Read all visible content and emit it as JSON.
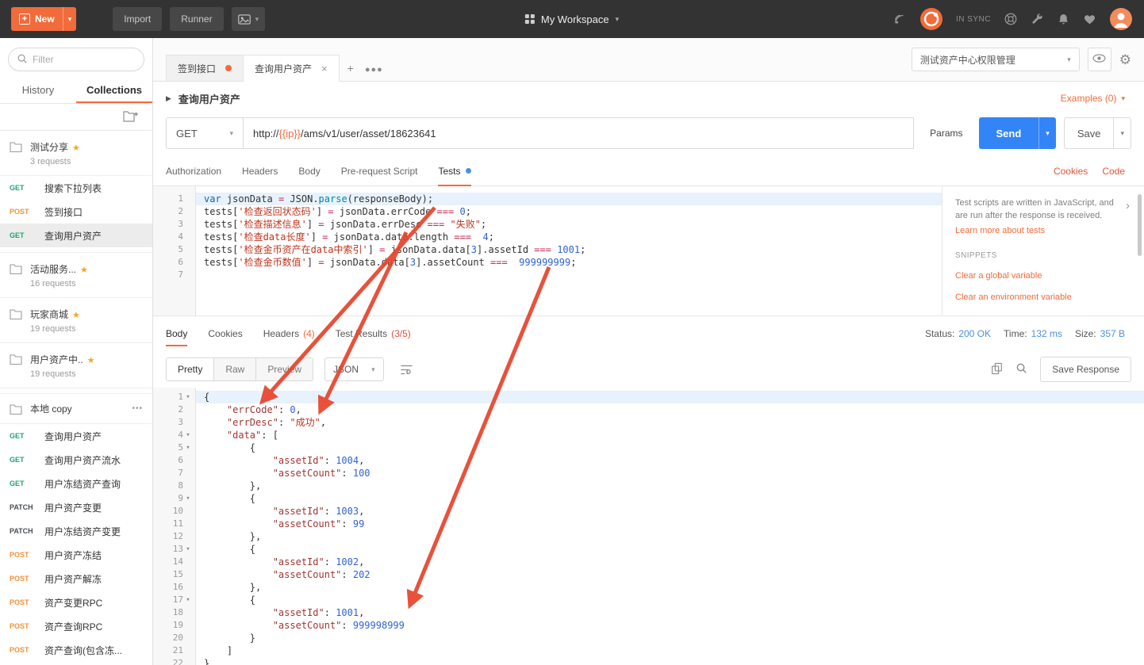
{
  "colors": {
    "accent": "#f26b3a",
    "send_blue": "#3385f7",
    "status_blue": "#4a90e2"
  },
  "icons": {
    "topbar": [
      "capture-icon",
      "postman-logo-icon",
      "help-icon",
      "wrench-icon",
      "bell-icon",
      "heart-icon",
      "avatar"
    ],
    "sidebar": [
      "search-icon",
      "new-folder-icon",
      "folder-icon",
      "more-icon",
      "star-icon"
    ],
    "main": [
      "eye-icon",
      "gear-icon",
      "copy-icon",
      "search-icon",
      "wrap-text-icon",
      "fold-caret-icon",
      "chevron-right-icon"
    ]
  },
  "topbar": {
    "new": "New",
    "import": "Import",
    "runner": "Runner",
    "workspace": "My Workspace",
    "sync_status": "IN SYNC"
  },
  "sidebar": {
    "filter_placeholder": "Filter",
    "tabs": {
      "history": "History",
      "collections": "Collections"
    },
    "items": [
      {
        "kind": "collection",
        "name": "测试分享",
        "starred": true,
        "meta": "3 requests"
      },
      {
        "kind": "request",
        "method": "GET",
        "name": "搜索下拉列表"
      },
      {
        "kind": "request",
        "method": "POST",
        "name": "签到接口"
      },
      {
        "kind": "request",
        "method": "GET",
        "name": "查询用户资产",
        "selected": true
      },
      {
        "kind": "collection",
        "name": "活动服务...",
        "starred": true,
        "meta": "16 requests"
      },
      {
        "kind": "collection",
        "name": "玩家商城",
        "starred": true,
        "meta": "19 requests"
      },
      {
        "kind": "collection",
        "name": "用户资产中..",
        "starred": true,
        "meta": "19 requests"
      },
      {
        "kind": "folder",
        "name": "本地 copy"
      },
      {
        "kind": "request",
        "method": "GET",
        "name": "查询用户资产"
      },
      {
        "kind": "request",
        "method": "GET",
        "name": "查询用户资产流水"
      },
      {
        "kind": "request",
        "method": "GET",
        "name": "用户冻结资产查询"
      },
      {
        "kind": "request",
        "method": "PATCH",
        "name": "用户资产变更"
      },
      {
        "kind": "request",
        "method": "PATCH",
        "name": "用户冻结资产变更"
      },
      {
        "kind": "request",
        "method": "POST",
        "name": "用户资产冻结"
      },
      {
        "kind": "request",
        "method": "POST",
        "name": "用户资产解冻"
      },
      {
        "kind": "request",
        "method": "POST",
        "name": "资产变更RPC"
      },
      {
        "kind": "request",
        "method": "POST",
        "name": "资产查询RPC"
      },
      {
        "kind": "request",
        "method": "POST",
        "name": "资产查询(包含冻..."
      }
    ]
  },
  "tabstrip": {
    "tabs": [
      {
        "label": "签到接口",
        "dirty": true
      },
      {
        "label": "查询用户资产",
        "active": true,
        "closable": true
      }
    ],
    "environment": "测试资产中心权限管理"
  },
  "request": {
    "title": "查询用户资产",
    "examples_label": "Examples (0)",
    "method": "GET",
    "url_parts": [
      {
        "t": "http://"
      },
      {
        "t": "{{ip}}",
        "c": "tpl"
      },
      {
        "t": "/ams/v1/user/asset/18623641"
      }
    ],
    "params_label": "Params",
    "send_label": "Send",
    "save_label": "Save",
    "tabs": [
      {
        "label": "Authorization"
      },
      {
        "label": "Headers"
      },
      {
        "label": "Body"
      },
      {
        "label": "Pre-request Script"
      },
      {
        "label": "Tests",
        "active": true,
        "dot": true
      }
    ],
    "cookies_label": "Cookies",
    "code_label": "Code"
  },
  "tests_editor": {
    "lines": [
      {
        "no": 1,
        "active": true,
        "tokens": [
          {
            "t": "var ",
            "c": "k"
          },
          {
            "t": "jsonData "
          },
          {
            "t": "=",
            "c": "o"
          },
          {
            "t": " "
          },
          {
            "t": "JSON"
          },
          {
            "t": "."
          },
          {
            "t": "parse",
            "c": "f"
          },
          {
            "t": "("
          },
          {
            "t": "responseBody"
          },
          {
            "t": ");"
          }
        ]
      },
      {
        "no": 2,
        "tokens": [
          {
            "t": "tests["
          },
          {
            "t": "'检查返回状态码'",
            "c": "s"
          },
          {
            "t": "] "
          },
          {
            "t": "=",
            "c": "o"
          },
          {
            "t": " jsonData.errCode "
          },
          {
            "t": "===",
            "c": "o"
          },
          {
            "t": " "
          },
          {
            "t": "0",
            "c": "n"
          },
          {
            "t": ";"
          }
        ]
      },
      {
        "no": 3,
        "tokens": [
          {
            "t": "tests["
          },
          {
            "t": "'检查描述信息'",
            "c": "s"
          },
          {
            "t": "] "
          },
          {
            "t": "=",
            "c": "o"
          },
          {
            "t": " jsonData.errDesc "
          },
          {
            "t": "===",
            "c": "o"
          },
          {
            "t": " "
          },
          {
            "t": "\"失败\"",
            "c": "s"
          },
          {
            "t": ";"
          }
        ]
      },
      {
        "no": 4,
        "tokens": [
          {
            "t": "tests["
          },
          {
            "t": "'检查data长度'",
            "c": "s"
          },
          {
            "t": "] "
          },
          {
            "t": "=",
            "c": "o"
          },
          {
            "t": " jsonData.data.length "
          },
          {
            "t": "===",
            "c": "o"
          },
          {
            "t": "  "
          },
          {
            "t": "4",
            "c": "n"
          },
          {
            "t": ";"
          }
        ]
      },
      {
        "no": 5,
        "tokens": [
          {
            "t": "tests["
          },
          {
            "t": "'检查金币资产在data中索引'",
            "c": "s"
          },
          {
            "t": "] "
          },
          {
            "t": "=",
            "c": "o"
          },
          {
            "t": " jsonData.data["
          },
          {
            "t": "3",
            "c": "n"
          },
          {
            "t": "].assetId "
          },
          {
            "t": "===",
            "c": "o"
          },
          {
            "t": " "
          },
          {
            "t": "1001",
            "c": "n"
          },
          {
            "t": ";"
          }
        ]
      },
      {
        "no": 6,
        "tokens": [
          {
            "t": "tests["
          },
          {
            "t": "'检查金币数值'",
            "c": "s"
          },
          {
            "t": "] "
          },
          {
            "t": "=",
            "c": "o"
          },
          {
            "t": " jsonData.data["
          },
          {
            "t": "3",
            "c": "n"
          },
          {
            "t": "].assetCount "
          },
          {
            "t": "===",
            "c": "o"
          },
          {
            "t": "  "
          },
          {
            "t": "999999999",
            "c": "n"
          },
          {
            "t": ";"
          }
        ]
      },
      {
        "no": 7,
        "tokens": []
      }
    ]
  },
  "tests_help": {
    "text": "Test scripts are written in JavaScript, and are run after the response is received.",
    "learn_link": "Learn more about tests",
    "snippets_title": "SNIPPETS",
    "snippets": [
      "Clear a global variable",
      "Clear an environment variable"
    ]
  },
  "response": {
    "tabs": [
      {
        "label": "Body",
        "active": true
      },
      {
        "label": "Cookies"
      },
      {
        "label": "Headers",
        "count": "(4)",
        "count_class": "count-orange"
      },
      {
        "label": "Test Results",
        "count": "(3/5)",
        "count_class": "count-red"
      }
    ],
    "status": {
      "label": "Status:",
      "value": "200 OK"
    },
    "time": {
      "label": "Time:",
      "value": "132 ms"
    },
    "size": {
      "label": "Size:",
      "value": "357 B"
    },
    "views": [
      {
        "label": "Pretty",
        "active": true
      },
      {
        "label": "Raw"
      },
      {
        "label": "Preview"
      }
    ],
    "format": "JSON",
    "save_label": "Save Response",
    "lines": [
      {
        "no": 1,
        "fold": true,
        "active": true,
        "tokens": [
          {
            "t": "{"
          }
        ]
      },
      {
        "no": 2,
        "tokens": [
          {
            "t": "    "
          },
          {
            "t": "\"errCode\"",
            "c": "key"
          },
          {
            "t": ": "
          },
          {
            "t": "0",
            "c": "num"
          },
          {
            "t": ","
          }
        ]
      },
      {
        "no": 3,
        "tokens": [
          {
            "t": "    "
          },
          {
            "t": "\"errDesc\"",
            "c": "key"
          },
          {
            "t": ": "
          },
          {
            "t": "\"成功\"",
            "c": "str"
          },
          {
            "t": ","
          }
        ]
      },
      {
        "no": 4,
        "fold": true,
        "tokens": [
          {
            "t": "    "
          },
          {
            "t": "\"data\"",
            "c": "key"
          },
          {
            "t": ": ["
          }
        ]
      },
      {
        "no": 5,
        "fold": true,
        "tokens": [
          {
            "t": "        {"
          }
        ]
      },
      {
        "no": 6,
        "tokens": [
          {
            "t": "            "
          },
          {
            "t": "\"assetId\"",
            "c": "key"
          },
          {
            "t": ": "
          },
          {
            "t": "1004",
            "c": "num"
          },
          {
            "t": ","
          }
        ]
      },
      {
        "no": 7,
        "tokens": [
          {
            "t": "            "
          },
          {
            "t": "\"assetCount\"",
            "c": "key"
          },
          {
            "t": ": "
          },
          {
            "t": "100",
            "c": "num"
          }
        ]
      },
      {
        "no": 8,
        "tokens": [
          {
            "t": "        },"
          }
        ]
      },
      {
        "no": 9,
        "fold": true,
        "tokens": [
          {
            "t": "        {"
          }
        ]
      },
      {
        "no": 10,
        "tokens": [
          {
            "t": "            "
          },
          {
            "t": "\"assetId\"",
            "c": "key"
          },
          {
            "t": ": "
          },
          {
            "t": "1003",
            "c": "num"
          },
          {
            "t": ","
          }
        ]
      },
      {
        "no": 11,
        "tokens": [
          {
            "t": "            "
          },
          {
            "t": "\"assetCount\"",
            "c": "key"
          },
          {
            "t": ": "
          },
          {
            "t": "99",
            "c": "num"
          }
        ]
      },
      {
        "no": 12,
        "tokens": [
          {
            "t": "        },"
          }
        ]
      },
      {
        "no": 13,
        "fold": true,
        "tokens": [
          {
            "t": "        {"
          }
        ]
      },
      {
        "no": 14,
        "tokens": [
          {
            "t": "            "
          },
          {
            "t": "\"assetId\"",
            "c": "key"
          },
          {
            "t": ": "
          },
          {
            "t": "1002",
            "c": "num"
          },
          {
            "t": ","
          }
        ]
      },
      {
        "no": 15,
        "tokens": [
          {
            "t": "            "
          },
          {
            "t": "\"assetCount\"",
            "c": "key"
          },
          {
            "t": ": "
          },
          {
            "t": "202",
            "c": "num"
          }
        ]
      },
      {
        "no": 16,
        "tokens": [
          {
            "t": "        },"
          }
        ]
      },
      {
        "no": 17,
        "fold": true,
        "tokens": [
          {
            "t": "        {"
          }
        ]
      },
      {
        "no": 18,
        "tokens": [
          {
            "t": "            "
          },
          {
            "t": "\"assetId\"",
            "c": "key"
          },
          {
            "t": ": "
          },
          {
            "t": "1001",
            "c": "num"
          },
          {
            "t": ","
          }
        ]
      },
      {
        "no": 19,
        "tokens": [
          {
            "t": "            "
          },
          {
            "t": "\"assetCount\"",
            "c": "key"
          },
          {
            "t": ": "
          },
          {
            "t": "999998999",
            "c": "num"
          }
        ]
      },
      {
        "no": 20,
        "tokens": [
          {
            "t": "        }"
          }
        ]
      },
      {
        "no": 21,
        "tokens": [
          {
            "t": "    ]"
          }
        ]
      },
      {
        "no": 22,
        "tokens": [
          {
            "t": "}"
          }
        ]
      }
    ]
  }
}
